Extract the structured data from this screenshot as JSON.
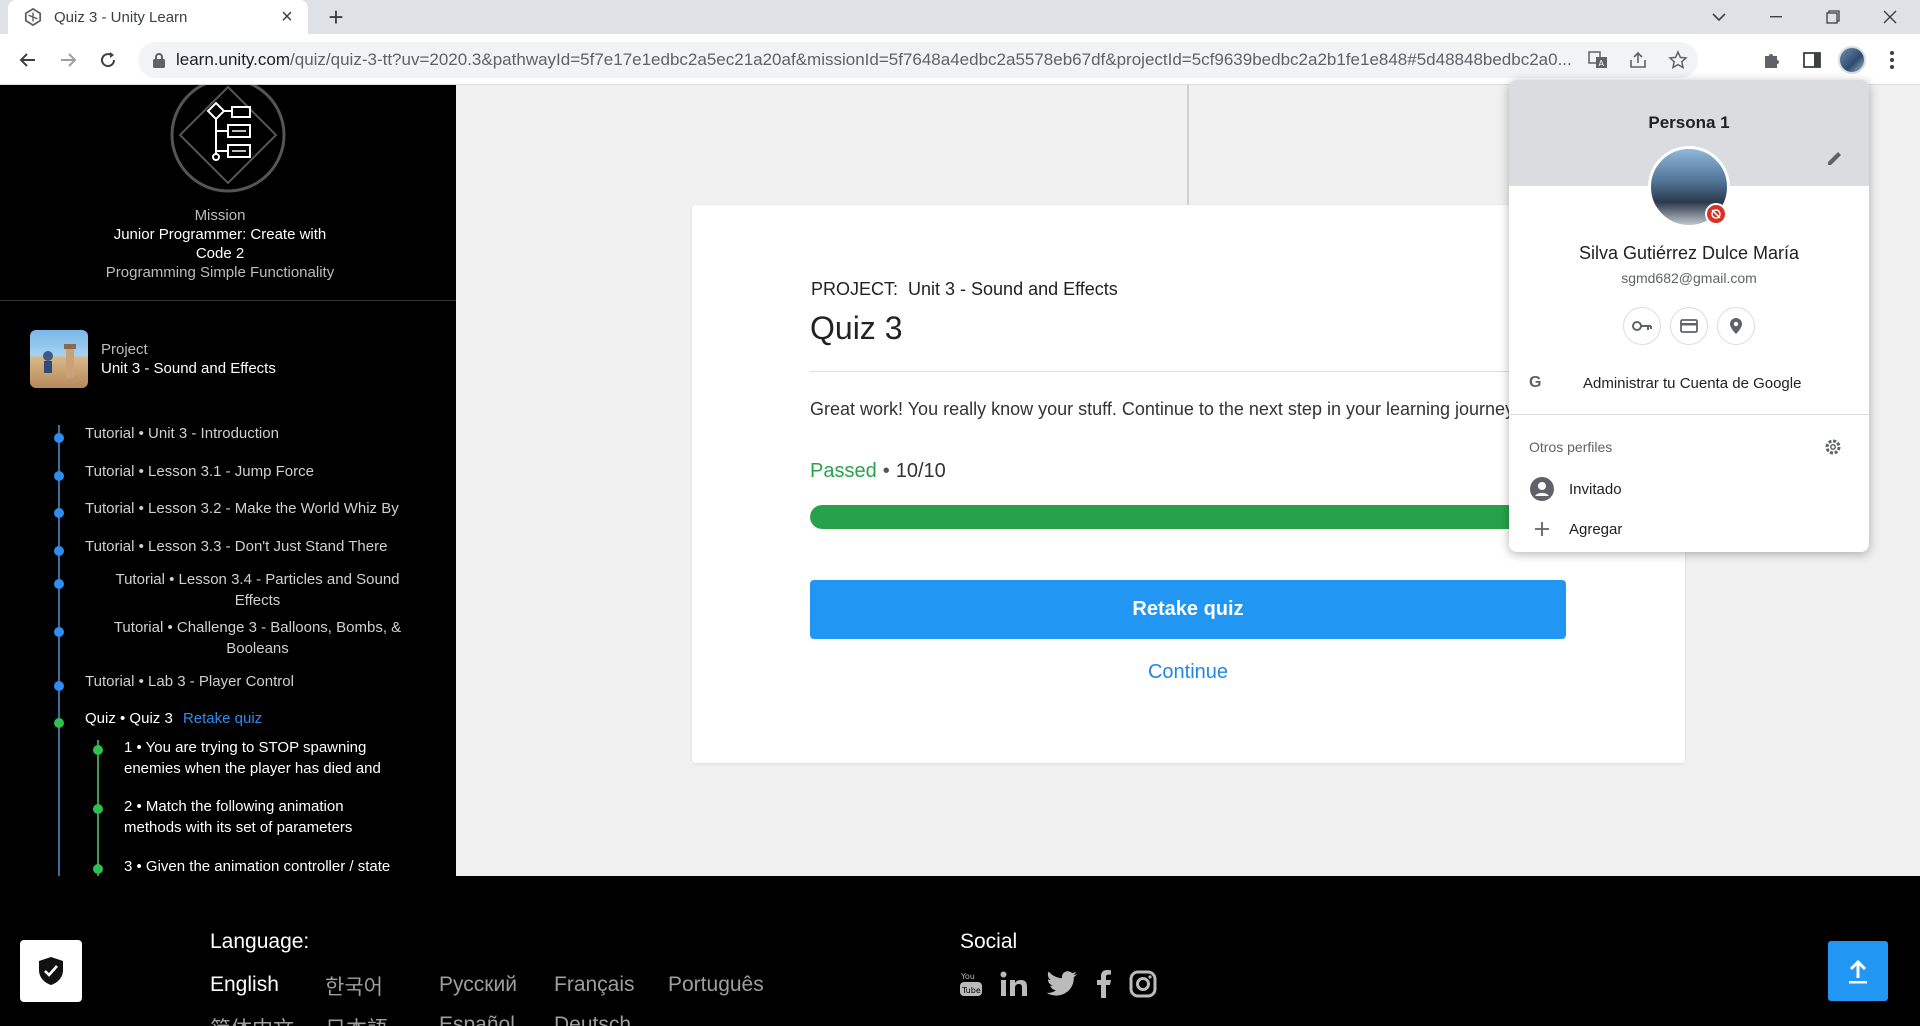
{
  "browser": {
    "tab_title": "Quiz 3 - Unity Learn",
    "url_host": "learn.unity.com",
    "url_path": "/quiz/quiz-3-tt?uv=2020.3&pathwayId=5f7e17e1edbc2a5ec21a20af&missionId=5f7648a4edbc2a5578eb67df&projectId=5cf9639bedbc2a2b1fe1e848#5d48848bedbc2a0..."
  },
  "sidebar": {
    "mission_kicker": "Mission",
    "mission_title_line1": "Junior Programmer: Create with",
    "mission_title_line2": "Code 2",
    "mission_subtitle": "Programming Simple Functionality",
    "project_kicker": "Project",
    "project_name": "Unit 3 - Sound and Effects",
    "steps": [
      {
        "label": "Tutorial • Unit 3 - Introduction"
      },
      {
        "label": "Tutorial • Lesson 3.1 - Jump Force"
      },
      {
        "label": "Tutorial • Lesson 3.2 - Make the World Whiz By"
      },
      {
        "label": "Tutorial • Lesson 3.3 - Don't Just Stand There"
      },
      {
        "line1": "Tutorial • Lesson 3.4 - Particles and Sound",
        "line2": "Effects"
      },
      {
        "line1": "Tutorial • Challenge 3 - Balloons, Bombs, &",
        "line2": "Booleans"
      },
      {
        "label": "Tutorial • Lab 3 - Player Control"
      },
      {
        "label": "Quiz • Quiz 3",
        "action": "Retake quiz"
      }
    ],
    "questions": [
      {
        "line1": "1 • You are trying to STOP spawning",
        "line2": "enemies when the player has died and"
      },
      {
        "line1": "2 • Match the following animation",
        "line2": "methods with its set of parameters"
      },
      {
        "line1": "3 • Given the animation controller / state",
        "line2": ""
      }
    ]
  },
  "quiz": {
    "project_label": "PROJECT:",
    "project_name": "Unit 3 - Sound and Effects",
    "title": "Quiz 3",
    "message": "Great work! You really know your stuff. Continue to the next step in your learning journey.",
    "status": "Passed",
    "score": "10/10",
    "progress_fraction": 1.0,
    "retake_label": "Retake quiz",
    "continue_label": "Continue"
  },
  "profile": {
    "header_name": "Persona 1",
    "full_name": "Silva Gutiérrez Dulce María",
    "email": "sgmd682@gmail.com",
    "manage_account": "Administrar tu Cuenta de Google",
    "other_profiles": "Otros perfiles",
    "guest": "Invitado",
    "add": "Agregar"
  },
  "footer": {
    "language_title": "Language:",
    "languages": [
      "English",
      "한국어",
      "Русский",
      "Français",
      "Português",
      "简体中文",
      "日本語",
      "Español",
      "Deutsch"
    ],
    "social_title": "Social"
  },
  "colors": {
    "accent_blue": "#2196f3",
    "pass_green": "#27a24a",
    "track_blue": "#2f8cf0",
    "track_green": "#30c04f"
  }
}
